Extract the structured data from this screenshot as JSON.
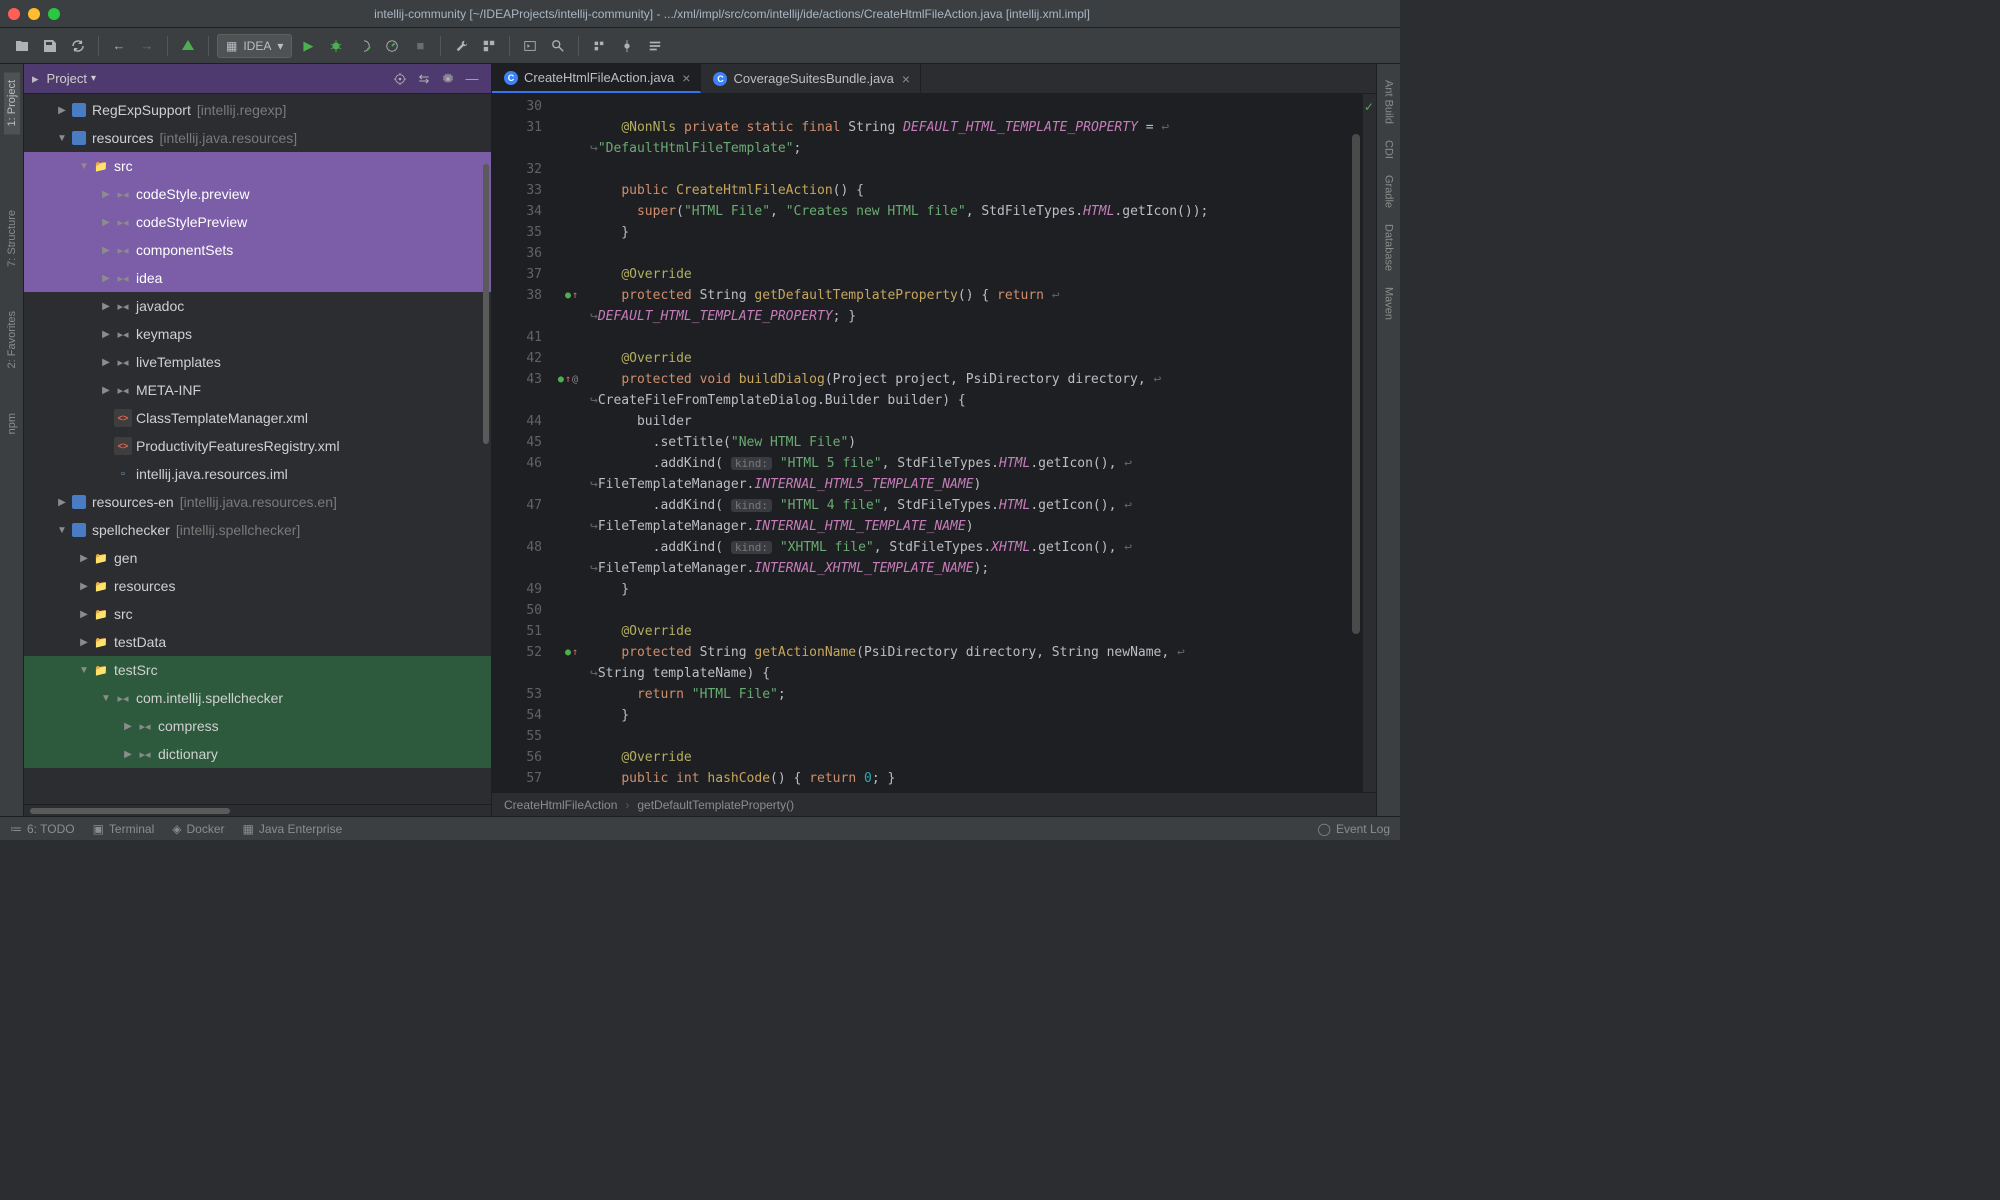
{
  "window_title": "intellij-community [~/IDEAProjects/intellij-community] - .../xml/impl/src/com/intellij/ide/actions/CreateHtmlFileAction.java [intellij.xml.impl]",
  "run_config": "IDEA",
  "panel": {
    "title": "Project"
  },
  "tree": [
    {
      "d": 1,
      "a": "▶",
      "ic": "module",
      "label": "RegExpSupport",
      "extra": "[intellij.regexp]"
    },
    {
      "d": 1,
      "a": "▼",
      "ic": "module",
      "label": "resources",
      "extra": "[intellij.java.resources]"
    },
    {
      "d": 2,
      "a": "▼",
      "ic": "folder-src",
      "label": "src",
      "sel": "purple"
    },
    {
      "d": 3,
      "a": "▶",
      "ic": "folder-pkg",
      "label": "codeStyle.preview",
      "sel": "purple"
    },
    {
      "d": 3,
      "a": "▶",
      "ic": "folder-pkg",
      "label": "codeStylePreview",
      "sel": "purple"
    },
    {
      "d": 3,
      "a": "▶",
      "ic": "folder-pkg",
      "label": "componentSets",
      "sel": "purple"
    },
    {
      "d": 3,
      "a": "▶",
      "ic": "folder-pkg",
      "label": "idea",
      "sel": "purple"
    },
    {
      "d": 3,
      "a": "▶",
      "ic": "folder-pkg",
      "label": "javadoc"
    },
    {
      "d": 3,
      "a": "▶",
      "ic": "folder-pkg",
      "label": "keymaps"
    },
    {
      "d": 3,
      "a": "▶",
      "ic": "folder-pkg",
      "label": "liveTemplates"
    },
    {
      "d": 3,
      "a": "▶",
      "ic": "folder-pkg",
      "label": "META-INF"
    },
    {
      "d": 3,
      "a": "",
      "ic": "xml",
      "label": "ClassTemplateManager.xml"
    },
    {
      "d": 3,
      "a": "",
      "ic": "xml",
      "label": "ProductivityFeaturesRegistry.xml"
    },
    {
      "d": 3,
      "a": "",
      "ic": "iml",
      "label": "intellij.java.resources.iml"
    },
    {
      "d": 1,
      "a": "▶",
      "ic": "module",
      "label": "resources-en",
      "extra": "[intellij.java.resources.en]"
    },
    {
      "d": 1,
      "a": "▼",
      "ic": "module",
      "label": "spellchecker",
      "extra": "[intellij.spellchecker]"
    },
    {
      "d": 2,
      "a": "▶",
      "ic": "folder-gen",
      "label": "gen"
    },
    {
      "d": 2,
      "a": "▶",
      "ic": "folder",
      "label": "resources"
    },
    {
      "d": 2,
      "a": "▶",
      "ic": "folder-src",
      "label": "src"
    },
    {
      "d": 2,
      "a": "▶",
      "ic": "folder",
      "label": "testData"
    },
    {
      "d": 2,
      "a": "▼",
      "ic": "folder-test",
      "label": "testSrc",
      "sel": "green"
    },
    {
      "d": 3,
      "a": "▼",
      "ic": "folder-pkg",
      "label": "com.intellij.spellchecker",
      "sel": "green"
    },
    {
      "d": 4,
      "a": "▶",
      "ic": "folder-pkg",
      "label": "compress",
      "sel": "green"
    },
    {
      "d": 4,
      "a": "▶",
      "ic": "folder-pkg",
      "label": "dictionary",
      "sel": "green"
    }
  ],
  "tabs": [
    {
      "label": "CreateHtmlFileAction.java",
      "active": true
    },
    {
      "label": "CoverageSuitesBundle.java",
      "active": false
    }
  ],
  "lines": [
    "30",
    "31",
    "",
    "32",
    "33",
    "34",
    "35",
    "36",
    "37",
    "38",
    "",
    "41",
    "42",
    "43",
    "",
    "44",
    "45",
    "46",
    "",
    "47",
    "",
    "48",
    "",
    "49",
    "50",
    "51",
    "52",
    "",
    "53",
    "54",
    "55",
    "56",
    "57"
  ],
  "gutter_marks": {
    "9": "o↑",
    "13": "o↑ @",
    "26": "o↑"
  },
  "code_lines": [
    "",
    "    <span class='ann'>@NonNls</span> <span class='kw'>private static final</span> String <span class='const'>DEFAULT_HTML_TEMPLATE_PROPERTY</span> = <span class='wrap-arrow'>↩</span>",
    "<span class='wrap-arrow'>↪</span><span class='str'>\"DefaultHtmlFileTemplate\"</span>;",
    "",
    "    <span class='kw'>public</span> <span class='fn'>CreateHtmlFileAction</span>() {",
    "      <span class='kw'>super</span>(<span class='str'>\"HTML File\"</span>, <span class='str'>\"Creates new HTML file\"</span>, StdFileTypes.<span class='const'>HTML</span>.getIcon());",
    "    }",
    "",
    "    <span class='ann'>@Override</span>",
    "    <span class='kw'>protected</span> String <span class='fn'>getDefaultTemplateProperty</span>() { <span class='kw'>return</span> <span class='wrap-arrow'>↩</span>",
    "<span class='wrap-arrow'>↪</span><span class='const'>DEFAULT_HTML_TEMPLATE_PROPERTY</span>; }",
    "",
    "    <span class='ann'>@Override</span>",
    "    <span class='kw'>protected void</span> <span class='fn'>buildDialog</span>(Project project, PsiDirectory directory, <span class='wrap-arrow'>↩</span>",
    "<span class='wrap-arrow'>↪</span>CreateFileFromTemplateDialog.Builder builder) {",
    "      builder",
    "        .setTitle(<span class='str'>\"New HTML File\"</span>)",
    "        .addKind( <span class='param-hint'>kind:</span> <span class='str'>\"HTML 5 file\"</span>, StdFileTypes.<span class='const'>HTML</span>.getIcon(), <span class='wrap-arrow'>↩</span>",
    "<span class='wrap-arrow'>↪</span>FileTemplateManager.<span class='const'>INTERNAL_HTML5_TEMPLATE_NAME</span>)",
    "        .addKind( <span class='param-hint'>kind:</span> <span class='str'>\"HTML 4 file\"</span>, StdFileTypes.<span class='const'>HTML</span>.getIcon(), <span class='wrap-arrow'>↩</span>",
    "<span class='wrap-arrow'>↪</span>FileTemplateManager.<span class='const'>INTERNAL_HTML_TEMPLATE_NAME</span>)",
    "        .addKind( <span class='param-hint'>kind:</span> <span class='str'>\"XHTML file\"</span>, StdFileTypes.<span class='const'>XHTML</span>.getIcon(), <span class='wrap-arrow'>↩</span>",
    "<span class='wrap-arrow'>↪</span>FileTemplateManager.<span class='const'>INTERNAL_XHTML_TEMPLATE_NAME</span>);",
    "    }",
    "",
    "    <span class='ann'>@Override</span>",
    "    <span class='kw'>protected</span> String <span class='fn'>getActionName</span>(PsiDirectory directory, String newName, <span class='wrap-arrow'>↩</span>",
    "<span class='wrap-arrow'>↪</span>String templateName) {",
    "      <span class='kw'>return</span> <span class='str'>\"HTML File\"</span>;",
    "    }",
    "",
    "    <span class='ann'>@Override</span>",
    "    <span class='kw'>public int</span> <span class='fn'>hashCode</span>() { <span class='kw'>return</span> <span class='num'>0</span>; }"
  ],
  "breadcrumb": [
    "CreateHtmlFileAction",
    "getDefaultTemplateProperty()"
  ],
  "left_rail": [
    "1: Project",
    "7: Structure",
    "2: Favorites",
    "npm"
  ],
  "right_rail": [
    "Ant Build",
    "CDI",
    "Gradle",
    "Database",
    "Maven"
  ],
  "statusbar": {
    "todo": "6: TODO",
    "terminal": "Terminal",
    "docker": "Docker",
    "je": "Java Enterprise",
    "eventlog": "Event Log"
  }
}
